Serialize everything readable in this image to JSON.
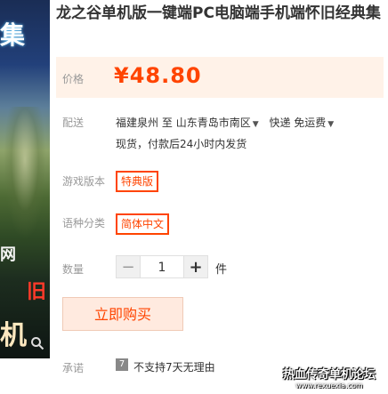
{
  "product": {
    "title": "龙之谷单机版一键端PC电脑端手机端怀旧经典集",
    "image_text": {
      "top": "集",
      "mid": "网",
      "red": "旧",
      "bottom": "机"
    }
  },
  "price": {
    "label": "价格",
    "value": "¥48.80"
  },
  "shipping": {
    "label": "配送",
    "from": "福建泉州",
    "to_word": "至",
    "to": "山东青岛市南区",
    "method": "快递 免运费",
    "note": "现货，付款后24小时内发货"
  },
  "options": {
    "version": {
      "label": "游戏版本",
      "selected": "特典版"
    },
    "language": {
      "label": "语种分类",
      "selected": "简体中文"
    }
  },
  "quantity": {
    "label": "数量",
    "value": "1",
    "minus": "−",
    "plus": "+",
    "unit": "件"
  },
  "buy_button": "立即购买",
  "promise": {
    "label": "承诺",
    "icon": "7",
    "text": "不支持7天无理由"
  },
  "watermark": {
    "line1": "热血传奇单机论坛",
    "line2": "www.rexuexia.com"
  },
  "colors": {
    "accent": "#ff4400",
    "price_bg": "#fff2e8",
    "buy_bg": "#ffeadf"
  }
}
